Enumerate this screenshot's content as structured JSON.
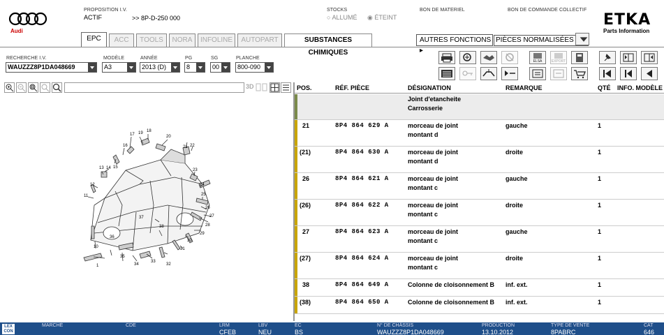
{
  "brand": {
    "audi_label": "Audi",
    "etka_title": "ETKA",
    "etka_subtitle": "Parts Information"
  },
  "proposition": {
    "label": "PROPOSITION I.V.",
    "status": "ACTIF",
    "path": ">> 8P-D-250 000"
  },
  "stocks": {
    "label": "STOCKS",
    "on_label": "ALLUMÉ",
    "off_label": "ÉTEINT",
    "selected": "ÉTEINT"
  },
  "links": {
    "bon_materiel": "BON DE MATERIEL",
    "bon_commande": "BON DE COMMANDE COLLECTIF"
  },
  "tabs": [
    {
      "label": "EPC",
      "state": "active"
    },
    {
      "label": "ACC",
      "state": "disabled"
    },
    {
      "label": "TOOLS",
      "state": "disabled"
    },
    {
      "label": "NORA",
      "state": "disabled"
    },
    {
      "label": "INFOLINE",
      "state": "disabled"
    },
    {
      "label": "AUTOPART",
      "state": "disabled"
    },
    {
      "label": "SUBSTANCES CHIMIQUES",
      "state": "enabled"
    }
  ],
  "autres": {
    "label": "AUTRES FONCTIONS",
    "value": "PIÈCES NORMALISÉES"
  },
  "search": {
    "vin_label": "RECHERCHE I.V.",
    "vin_value": "WAUZZZ8P1DA048669",
    "modele_label": "MODÈLE",
    "modele_value": "A3",
    "annee_label": "ANNÉE",
    "annee_value": "2013 (D)",
    "pg_label": "PG",
    "pg_value": "8",
    "sg_label": "SG",
    "sg_value": "00",
    "planche_label": "PLANCHE",
    "planche_value": "800-090"
  },
  "viewer": {
    "mode_3d": "3D"
  },
  "grid": {
    "headers": {
      "pos": "POS.",
      "ref": "RÉF. PIÈCE",
      "des": "DÉSIGNATION",
      "rem": "REMARQUE",
      "qte": "QTÉ",
      "info": "INFO. MODÈLE"
    },
    "group": {
      "line1": "Joint d'etancheite",
      "line2": "Carrosserie"
    },
    "rows": [
      {
        "pos": "21",
        "ref": "8P4 864 629 A",
        "des1": "morceau de joint",
        "des2": "montant d",
        "rem": "gauche",
        "qte": "1"
      },
      {
        "pos": "(21)",
        "ref": "8P4 864 630 A",
        "des1": "morceau de joint",
        "des2": "montant d",
        "rem": "droite",
        "qte": "1"
      },
      {
        "pos": "26",
        "ref": "8P4 864 621 A",
        "des1": "morceau de joint",
        "des2": "montant c",
        "rem": "gauche",
        "qte": "1"
      },
      {
        "pos": "(26)",
        "ref": "8P4 864 622 A",
        "des1": "morceau de joint",
        "des2": "montant c",
        "rem": "droite",
        "qte": "1"
      },
      {
        "pos": "27",
        "ref": "8P4 864 623 A",
        "des1": "morceau de joint",
        "des2": "montant c",
        "rem": "gauche",
        "qte": "1"
      },
      {
        "pos": "(27)",
        "ref": "8P4 864 624 A",
        "des1": "morceau de joint",
        "des2": "montant c",
        "rem": "droite",
        "qte": "1"
      },
      {
        "pos": "38",
        "ref": "8P4 864 649 A",
        "des1": "Colonne de cloisonnement B",
        "des2": "",
        "rem": "inf. ext.",
        "qte": "1"
      },
      {
        "pos": "(38)",
        "ref": "8P4 864 650 A",
        "des1": "Colonne de cloisonnement B",
        "des2": "",
        "rem": "inf. ext.",
        "qte": "1"
      }
    ]
  },
  "diagram_labels": [
    "19",
    "18",
    "20",
    "17",
    "16",
    "15",
    "14",
    "13",
    "12",
    "11",
    "1",
    "10",
    "22",
    "21",
    "23",
    "24",
    "25",
    "26",
    "27",
    "28",
    "29",
    "30",
    "31",
    "32",
    "33",
    "34",
    "35",
    "36",
    "37",
    "38"
  ],
  "footer": {
    "lex": "LEX CON",
    "marche_label": "MARCHÉ",
    "cde_label": "CDE",
    "lrm_label": "LRM",
    "lrm_value": "CFEB",
    "lbv_label": "LBV",
    "lbv_value": "NEU",
    "ec_label": "EC",
    "ec_value": "BS",
    "chassis_label": "N° DE CHÂSSIS",
    "chassis_value": "WAUZZZ8P1DA048669",
    "production_label": "PRODUCTION",
    "production_value": "13.10.2012",
    "vente_label": "TYPE DE VENTE",
    "vente_value": "8PABRC",
    "cat_label": "CAT",
    "cat_value": "646"
  },
  "colors": {
    "row_bar": "#c9a500",
    "group_bar": "#7a8a4a",
    "footer_bg": "#1f4f8a"
  }
}
